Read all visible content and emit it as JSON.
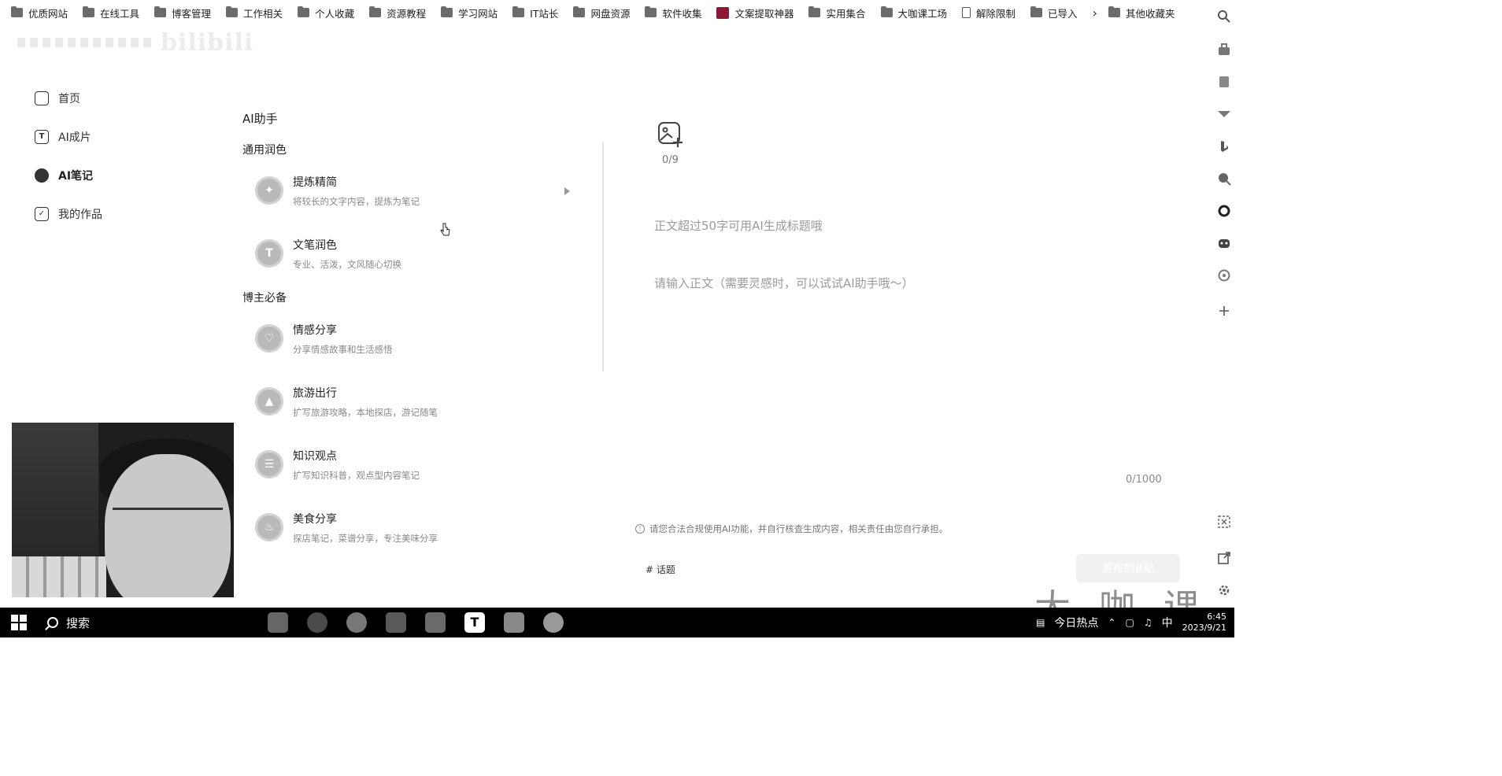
{
  "bookmarks": {
    "items": [
      {
        "label": "优质网站",
        "icon": "folder-icon"
      },
      {
        "label": "在线工具",
        "icon": "folder-icon"
      },
      {
        "label": "博客管理",
        "icon": "folder-icon"
      },
      {
        "label": "工作相关",
        "icon": "folder-icon"
      },
      {
        "label": "个人收藏",
        "icon": "folder-icon"
      },
      {
        "label": "资源教程",
        "icon": "folder-icon"
      },
      {
        "label": "学习网站",
        "icon": "folder-icon"
      },
      {
        "label": "IT站长",
        "icon": "folder-icon"
      },
      {
        "label": "网盘资源",
        "icon": "folder-icon"
      },
      {
        "label": "软件收集",
        "icon": "folder-icon"
      },
      {
        "label": "文案提取神器",
        "icon": "app-icon"
      },
      {
        "label": "实用集合",
        "icon": "folder-icon"
      },
      {
        "label": "大咖课工场",
        "icon": "folder-icon"
      },
      {
        "label": "解除限制",
        "icon": "document-icon"
      },
      {
        "label": "已导入",
        "icon": "folder-icon"
      }
    ],
    "overflow_icon": "chevron-right-icon",
    "other": "其他收藏夹"
  },
  "logo": {
    "text": "bilibili"
  },
  "nav": {
    "items": [
      {
        "label": "首页",
        "icon": "home-icon"
      },
      {
        "label": "AI成片",
        "icon": "text-t-icon"
      },
      {
        "label": "AI笔记",
        "icon": "ai-note-icon",
        "active": true
      },
      {
        "label": "我的作品",
        "icon": "works-check-icon"
      }
    ]
  },
  "helper": {
    "title": "AI助手",
    "sections": [
      {
        "title": "通用润色",
        "tools": [
          {
            "name": "提炼精简",
            "desc": "将较长的文字内容，提炼为笔记"
          },
          {
            "name": "文笔润色",
            "desc": "专业、活泼，文风随心切换"
          }
        ]
      },
      {
        "title": "博主必备",
        "tools": [
          {
            "name": "情感分享",
            "desc": "分享情感故事和生活感悟"
          },
          {
            "name": "旅游出行",
            "desc": "扩写旅游攻略，本地探店，游记随笔"
          },
          {
            "name": "知识观点",
            "desc": "扩写知识科普，观点型内容笔记"
          },
          {
            "name": "美食分享",
            "desc": "探店笔记，菜谱分享，专注美味分享"
          }
        ]
      }
    ]
  },
  "editor": {
    "image_count": "0/9",
    "title_placeholder": "正文超过50字可用AI生成标题哦",
    "body_placeholder": "请输入正文（需要灵感时，可以试试AI助手哦～）",
    "char_count": "0/1000",
    "notice": "请您合法合规使用AI功能，并自行核查生成内容，相关责任由您自行承担。",
    "topic": "# 话题",
    "publish_label": "发布到B站"
  },
  "taskbar": {
    "search_label": "搜索",
    "news_label": "今日热点",
    "ime": "中",
    "time": "6:45",
    "date": "2023/9/21"
  },
  "watermark": "大咖课"
}
